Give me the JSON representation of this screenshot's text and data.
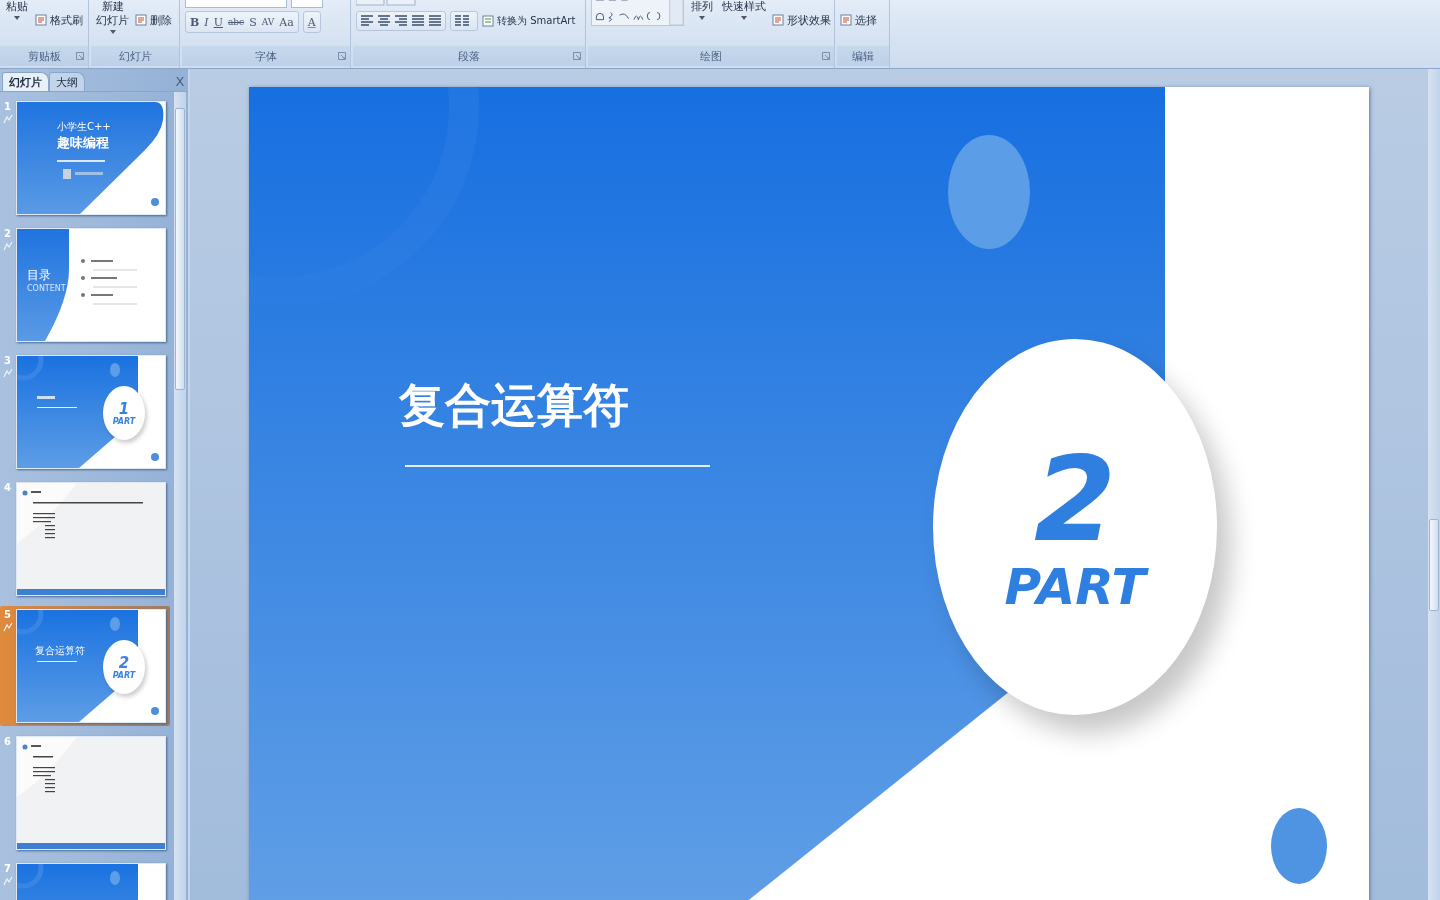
{
  "ribbon": {
    "groups": [
      {
        "label": "剪贴板",
        "launcher": true,
        "items": [
          {
            "kind": "large",
            "lines": [
              "粘贴"
            ],
            "caret": true
          },
          {
            "kind": "stack",
            "labels": [
              "格式刷"
            ]
          }
        ]
      },
      {
        "label": "幻灯片",
        "launcher": false,
        "items": [
          {
            "kind": "large",
            "lines": [
              "新建",
              "幻灯片"
            ],
            "caret": true
          },
          {
            "kind": "stack",
            "labels": [
              "删除"
            ]
          }
        ]
      },
      {
        "label": "字体",
        "launcher": true,
        "items": [
          {
            "kind": "font",
            "glyphs": [
              "B",
              "I",
              "U",
              "abc",
              "S",
              "AV",
              "Aa",
              "A"
            ]
          }
        ]
      },
      {
        "label": "段落",
        "launcher": true,
        "items": [
          {
            "kind": "paragraph",
            "labels": [
              "转换为 SmartArt"
            ]
          }
        ]
      },
      {
        "label": "绘图",
        "launcher": true,
        "items": [
          {
            "kind": "shapes"
          },
          {
            "kind": "large",
            "lines": [
              "排列"
            ],
            "caret": true
          },
          {
            "kind": "large",
            "lines": [
              "快速样式"
            ],
            "caret": true
          },
          {
            "kind": "stack",
            "labels": [
              "形状效果"
            ]
          }
        ]
      },
      {
        "label": "编辑",
        "launcher": false,
        "items": [
          {
            "kind": "stack",
            "labels": [
              "选择"
            ]
          }
        ]
      }
    ]
  },
  "pane": {
    "tabs": [
      {
        "label": "幻灯片",
        "selected": true
      },
      {
        "label": "大纲",
        "selected": false
      }
    ],
    "close": "X",
    "slides": [
      {
        "index": "1",
        "kind": "cover",
        "kicker": "小学生C++",
        "title": "趣味编程",
        "animated": true,
        "selected": false
      },
      {
        "index": "2",
        "kind": "toc",
        "title": "目录",
        "subtitle": "CONTENT",
        "animated": true,
        "selected": false
      },
      {
        "index": "3",
        "kind": "section",
        "number": "1",
        "part": "PART",
        "animated": true,
        "selected": false
      },
      {
        "index": "4",
        "kind": "code",
        "animated": false,
        "selected": false
      },
      {
        "index": "5",
        "kind": "section",
        "title": "复合运算符",
        "number": "2",
        "part": "PART",
        "animated": true,
        "selected": true
      },
      {
        "index": "6",
        "kind": "code",
        "animated": false,
        "selected": false
      },
      {
        "index": "7",
        "kind": "section",
        "animated": true,
        "selected": false
      }
    ]
  },
  "slide": {
    "title": "复合运算符",
    "number": "2",
    "part": "PART"
  }
}
